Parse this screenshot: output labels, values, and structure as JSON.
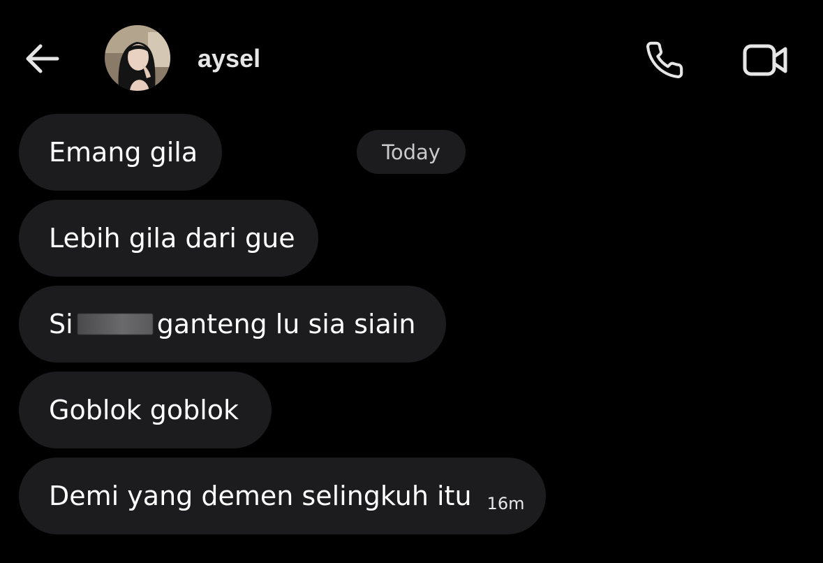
{
  "header": {
    "contact_name": "aysel",
    "back_icon": "arrow-left-icon",
    "call_icon": "phone-icon",
    "video_icon": "video-camera-icon"
  },
  "date_separator": "Today",
  "messages": [
    {
      "text": "Emang gila"
    },
    {
      "text": "Lebih gila dari gue"
    },
    {
      "text_before": "Si",
      "text_after": "ganteng lu sia siain",
      "redacted": true
    },
    {
      "text": "Goblok goblok"
    },
    {
      "text": "Demi yang demen selingkuh itu",
      "time": "16m"
    }
  ],
  "colors": {
    "background": "#000000",
    "bubble": "#1c1c1e",
    "text": "#ffffff",
    "muted_text": "#c9c9cc"
  }
}
